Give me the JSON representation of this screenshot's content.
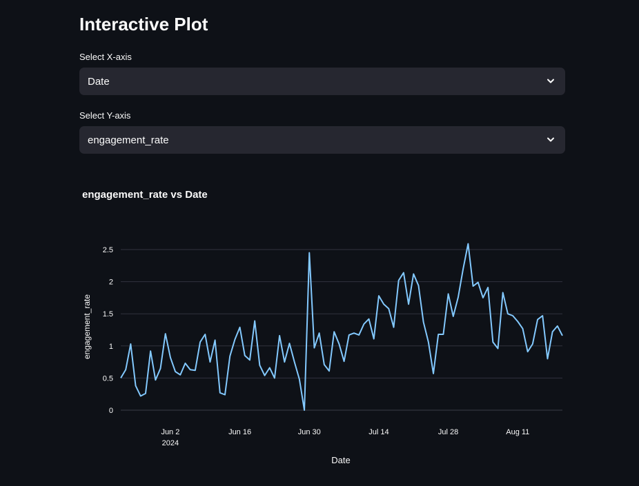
{
  "page": {
    "title": "Interactive Plot"
  },
  "controls": {
    "x_axis": {
      "label": "Select X-axis",
      "value": "Date"
    },
    "y_axis": {
      "label": "Select Y-axis",
      "value": "engagement_rate"
    }
  },
  "icons": {
    "dropdown": "chevron-down-icon"
  },
  "colors": {
    "background": "#0e1117",
    "select_bg": "#262730",
    "line": "#83c9ff",
    "grid": "#31333f"
  },
  "chart_data": {
    "type": "line",
    "title": "engagement_rate vs Date",
    "xlabel": "Date",
    "ylabel": "engagement_rate",
    "ylim": [
      0,
      2.5
    ],
    "grid": true,
    "x_start": "2024-05-23",
    "x_ticks": [
      {
        "date": "2024-06-02",
        "label": "Jun 2",
        "sublabel": "2024"
      },
      {
        "date": "2024-06-16",
        "label": "Jun 16",
        "sublabel": ""
      },
      {
        "date": "2024-06-30",
        "label": "Jun 30",
        "sublabel": ""
      },
      {
        "date": "2024-07-14",
        "label": "Jul 14",
        "sublabel": ""
      },
      {
        "date": "2024-07-28",
        "label": "Jul 28",
        "sublabel": ""
      },
      {
        "date": "2024-08-11",
        "label": "Aug 11",
        "sublabel": ""
      }
    ],
    "y_ticks": [
      0,
      0.5,
      1,
      1.5,
      2,
      2.5
    ],
    "series": [
      {
        "values": [
          0.5,
          0.63,
          1.03,
          0.38,
          0.22,
          0.26,
          0.92,
          0.47,
          0.65,
          1.19,
          0.82,
          0.6,
          0.55,
          0.73,
          0.63,
          0.62,
          1.06,
          1.18,
          0.75,
          1.09,
          0.27,
          0.24,
          0.84,
          1.1,
          1.29,
          0.85,
          0.78,
          1.39,
          0.7,
          0.54,
          0.66,
          0.5,
          1.16,
          0.75,
          1.04,
          0.75,
          0.48,
          0.0,
          2.45,
          0.97,
          1.2,
          0.71,
          0.61,
          1.22,
          1.03,
          0.76,
          1.17,
          1.2,
          1.17,
          1.34,
          1.42,
          1.11,
          1.78,
          1.65,
          1.58,
          1.29,
          2.02,
          2.14,
          1.65,
          2.12,
          1.94,
          1.37,
          1.06,
          0.57,
          1.18,
          1.18,
          1.81,
          1.46,
          1.76,
          2.2,
          2.59,
          1.93,
          1.99,
          1.75,
          1.91,
          1.06,
          0.96,
          1.83,
          1.5,
          1.47,
          1.38,
          1.27,
          0.91,
          1.03,
          1.41,
          1.47,
          0.8,
          1.22,
          1.31,
          1.16
        ]
      }
    ]
  }
}
